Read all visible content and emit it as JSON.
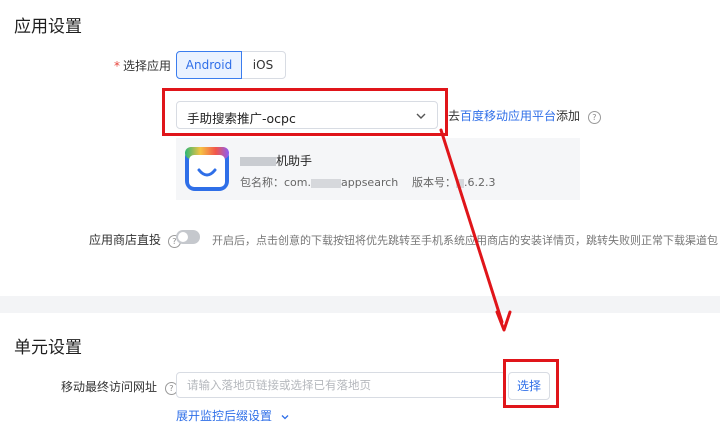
{
  "app_settings": {
    "title": "应用设置",
    "select_app_label": "选择应用",
    "platforms": [
      "Android",
      "iOS"
    ],
    "selected_app": "手助搜索推广-ocpc",
    "add_prefix": "去",
    "add_link": "百度移动应用平台",
    "add_suffix": "添加",
    "app_card": {
      "name": "机助手",
      "package_label": "包名称：",
      "package_value": "com.",
      "package_suffix": "appsearch",
      "version_label": "版本号：",
      "version_value": ".6.2.3"
    },
    "store_direct_label": "应用商店直投",
    "store_direct_desc": "开启后，点击创意的下载按钮将优先跳转至手机系统应用商店的安装详情页，跳转失败则正常下载渠道包",
    "store_direct_enabled": false
  },
  "unit_settings": {
    "title": "单元设置",
    "url_label": "移动最终访问网址",
    "url_colon": "：",
    "url_placeholder": "请输入落地页链接或选择已有落地页",
    "url_value": "",
    "choose_button": "选择",
    "expand_link": "展开监控后缀设置"
  },
  "colors": {
    "accent": "#2f6fe8",
    "annotation_red": "#e0151a",
    "required": "#e8453c"
  }
}
